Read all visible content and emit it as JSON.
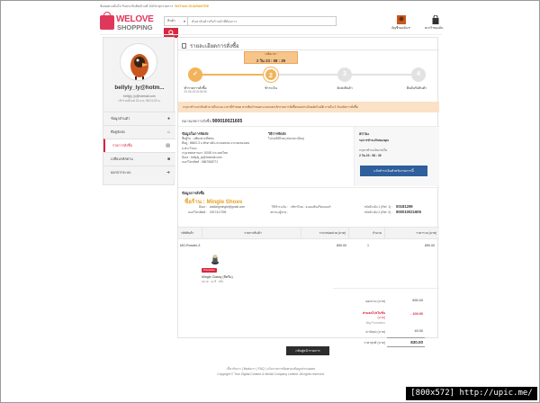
{
  "topbar": {
    "left_text": "ช้อปอย่างมั่นใจ รับประกันสินค้าแท้ 100% ทุกรายการ",
    "guarantee_label": "WeTrust GUARANTEE"
  },
  "logo": {
    "line1": "WELOVE",
    "line2": "SHOPPING"
  },
  "search": {
    "category_label": "สินค้า",
    "placeholder": "ค้นหาสินค้าหรือร้านค้าที่ต้องการ",
    "button_icon": "search-icon"
  },
  "header": {
    "account_label": "บัญชีของฉัน ▾",
    "cart_label": "ตะกร้าของฉัน"
  },
  "user": {
    "name": "bellyly_ly@hotm...",
    "email": "bellyly_ly@hotmail.com",
    "meta": "เข้าร่วมตั้งแต่ 31 ม.ค. 56 01:20 น."
  },
  "menu": [
    {
      "label": "ข้อมูลส่วนตัว",
      "icon": "user-icon"
    },
    {
      "label": "ที่อยู่จัดส่ง",
      "icon": "home-icon"
    },
    {
      "label": "รายการสั่งซื้อ",
      "icon": "cart-icon",
      "active": true
    },
    {
      "label": "เปลี่ยนรหัสผ่าน",
      "icon": "lock-icon"
    },
    {
      "label": "ออกจากระบบ",
      "icon": "logout-icon"
    }
  ],
  "page": {
    "title": "รายละเอียดการสั่งซื้อ"
  },
  "timer": {
    "label": "เหลือเวลา",
    "value": "2 วัน 23 : 58 : 39"
  },
  "steps": [
    {
      "label": "ทำรายการสั่งซื้อ",
      "date": "20-06-2015 08:08",
      "state": "done",
      "glyph": "✓"
    },
    {
      "label": "ชำระเงิน",
      "date": "",
      "state": "current",
      "glyph": "2"
    },
    {
      "label": "จัดส่งสินค้า",
      "date": "",
      "state": "todo",
      "glyph": "3"
    },
    {
      "label": "ยืนยันรับสินค้า",
      "date": "",
      "state": "todo",
      "glyph": "4"
    }
  ],
  "notice": "กรุณาชำระค่าสินค้าภายในระยะเวลาที่กำหนด หากพ้นกำหนดระบบจะยกเลิกรายการสั่งซื้อของท่านโดยอัตโนมัติ ภายใน 3 วันหลังการสั่งซื้อ",
  "order": {
    "label": "หมายเลขการสั่งซื้อ",
    "number": "900010021605"
  },
  "buyer": {
    "heading": "ข้อมูลในการจัดส่ง",
    "lines": [
      "ชื่อผู้รับ : แพ้ยกพวกลีฟพบ",
      "ที่อยู่ : 568/2-3 ถ.ศักดาเดิน ต.ทองหล่อ แขวงคลองเตย",
      "อ.พระโขนง",
      "กรุงเทพมหานคร 10000 ประเทศไทย",
      "อีเมล : bellyly_ly@hotmail.com",
      "เบอร์โทรศัพท์ : 0867568771"
    ]
  },
  "shipping": {
    "heading": "วิธีการจัดส่ง",
    "method": "ไปรษณีย์ไทย (ส่งลงทะเบียน)"
  },
  "payment_status": {
    "heading": "สถานะ",
    "status": "รอการชำระเงินของคุณ",
    "deadline_label": "กรุณาชำระเงินภายใน",
    "deadline": "2 วัน 23 : 58 : 39",
    "button": "แจ้งชำระเงินสำหรับรายการนี้"
  },
  "seller": {
    "heading": "ข้อมูลการสั่งซื้อ",
    "shop_label": "ชื่อร้าน : Mingle Shoes",
    "email_label": "อีเมล :",
    "email": "walkingmingle@gmail.com",
    "phone_label": "เบอร์โทรศัพท์ :",
    "phone": "0917417295",
    "pay_method_label": "วิธีชำระเงิน :",
    "pay_method": "กสิกรไทย - ธ.ออมสินเรียบแบงก์",
    "pay_status_label": "สถานะผู้ขาย :",
    "pay_status": "",
    "ref1_label": "รหัสอ้างอิง 1 (Ref. 1) :",
    "ref1": "00181299",
    "ref2_label": "รหัสอ้างอิง 2 (Ref. 2) :",
    "ref2": "900010021605"
  },
  "table": {
    "headers": [
      "รหัสสินค้า",
      "รายการสินค้า",
      "ราคาต่อหน่วย (บาท)",
      "จำนวน",
      "ราคารวม (บาท)"
    ],
    "rows": [
      {
        "sku": "MG-Powder-3",
        "promo": "Promotion",
        "name": "Mingle Classy (สีครีม)",
        "option": "ขนาด : 42 สี : ครีม",
        "unit_price": "890.00",
        "qty": "1",
        "total": "890.00"
      }
    ]
  },
  "summary": {
    "subtotal_label": "ยอดรวม (บาท)",
    "subtotal": "890.00",
    "discount_label": "ส่วนลดโปรโมชั่น",
    "discount_sub": "(บาท)",
    "discount": "- 100.00",
    "promo_name": "Big Promotion",
    "shipping_label": "ค่าจัดส่ง (บาท)",
    "shipping": "40.00",
    "total_label": "ราคาสุทธิ (บาท)",
    "total": "830.00"
  },
  "back_button": "กลับสู่หน้ารายการ",
  "footer": {
    "links": "เกี่ยวกับเรา  |  ติดต่อเรา  |  FAQ  |  นโยบายการคุ้มครองข้อมูลส่วนบุคคล",
    "copyright": "Copyright © True Digital Content & Media Company Limited. All rights reserved."
  },
  "watermark": "[800x572] http://upic.me/",
  "colors": {
    "accent": "#d7263d",
    "orange": "#f2b35b",
    "pay_button": "#2f5f9c"
  }
}
